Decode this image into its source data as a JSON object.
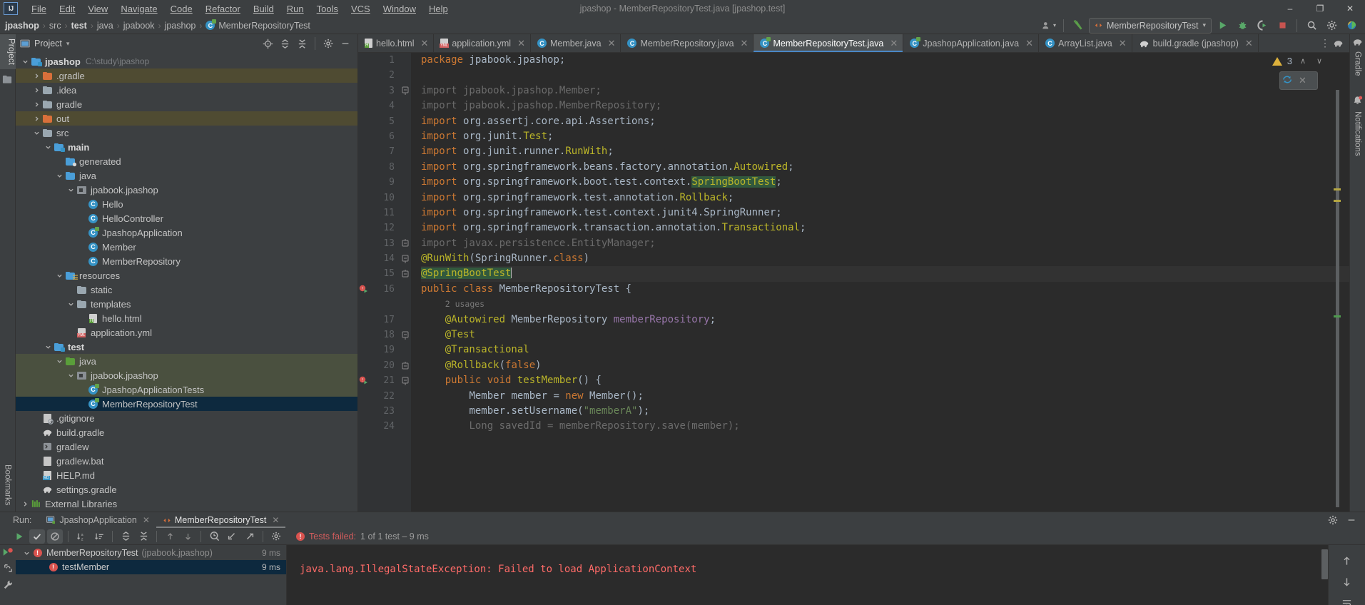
{
  "window": {
    "title": "jpashop - MemberRepositoryTest.java [jpashop.test]",
    "minimize": "–",
    "maximize": "❐",
    "close": "✕"
  },
  "menu": {
    "items": [
      "File",
      "Edit",
      "View",
      "Navigate",
      "Code",
      "Refactor",
      "Build",
      "Run",
      "Tools",
      "VCS",
      "Window",
      "Help"
    ]
  },
  "breadcrumb": {
    "items": [
      "jpashop",
      "src",
      "test",
      "java",
      "jpabook",
      "jpashop",
      "MemberRepositoryTest"
    ],
    "separator": "›"
  },
  "toolbar": {
    "run_config_label": "MemberRepositoryTest",
    "dropdown_caret": "▾",
    "run_title": "Run",
    "debug_title": "Debug",
    "coverage_title": "Run with Coverage",
    "stop_title": "Stop",
    "search_title": "Search Everywhere",
    "settings_title": "Settings",
    "updates_title": "Updates"
  },
  "project_panel": {
    "title": "Project",
    "caret": "▾",
    "actions": [
      "locate-icon",
      "expand-all-icon",
      "collapse-all-icon",
      "gear-icon",
      "hide-icon"
    ],
    "tree": [
      {
        "depth": 0,
        "arrow": "down",
        "icon": "module",
        "label": "jpashop",
        "bold": true,
        "path": "C:\\study\\jpashop",
        "state": ""
      },
      {
        "depth": 1,
        "arrow": "right",
        "icon": "folder-orange",
        "label": ".gradle",
        "state": "hl"
      },
      {
        "depth": 1,
        "arrow": "right",
        "icon": "folder",
        "label": ".idea",
        "state": ""
      },
      {
        "depth": 1,
        "arrow": "right",
        "icon": "folder",
        "label": "gradle",
        "state": ""
      },
      {
        "depth": 1,
        "arrow": "right",
        "icon": "folder-orange",
        "label": "out",
        "state": "hl"
      },
      {
        "depth": 1,
        "arrow": "down",
        "icon": "folder",
        "label": "src",
        "state": ""
      },
      {
        "depth": 2,
        "arrow": "down",
        "icon": "module",
        "label": "main",
        "bold": true,
        "state": ""
      },
      {
        "depth": 3,
        "arrow": "none",
        "icon": "folder-gen",
        "label": "generated",
        "state": ""
      },
      {
        "depth": 3,
        "arrow": "down",
        "icon": "folder-blue",
        "label": "java",
        "state": ""
      },
      {
        "depth": 4,
        "arrow": "down",
        "icon": "package",
        "label": "jpabook.jpashop",
        "state": ""
      },
      {
        "depth": 5,
        "arrow": "none",
        "icon": "class",
        "label": "Hello",
        "state": ""
      },
      {
        "depth": 5,
        "arrow": "none",
        "icon": "class",
        "label": "HelloController",
        "state": ""
      },
      {
        "depth": 5,
        "arrow": "none",
        "icon": "class-run",
        "label": "JpashopApplication",
        "state": ""
      },
      {
        "depth": 5,
        "arrow": "none",
        "icon": "class",
        "label": "Member",
        "state": ""
      },
      {
        "depth": 5,
        "arrow": "none",
        "icon": "class",
        "label": "MemberRepository",
        "state": ""
      },
      {
        "depth": 3,
        "arrow": "down",
        "icon": "folder-res",
        "label": "resources",
        "state": ""
      },
      {
        "depth": 4,
        "arrow": "none",
        "icon": "folder",
        "label": "static",
        "state": ""
      },
      {
        "depth": 4,
        "arrow": "down",
        "icon": "folder",
        "label": "templates",
        "state": ""
      },
      {
        "depth": 5,
        "arrow": "none",
        "icon": "file-html",
        "label": "hello.html",
        "state": ""
      },
      {
        "depth": 4,
        "arrow": "none",
        "icon": "file-yml",
        "label": "application.yml",
        "state": ""
      },
      {
        "depth": 2,
        "arrow": "down",
        "icon": "module",
        "label": "test",
        "bold": true,
        "state": ""
      },
      {
        "depth": 3,
        "arrow": "down",
        "icon": "folder-green",
        "label": "java",
        "state": "grp"
      },
      {
        "depth": 4,
        "arrow": "down",
        "icon": "package",
        "label": "jpabook.jpashop",
        "state": "grp"
      },
      {
        "depth": 5,
        "arrow": "none",
        "icon": "class-run",
        "label": "JpashopApplicationTests",
        "state": "grp"
      },
      {
        "depth": 5,
        "arrow": "none",
        "icon": "class-run",
        "label": "MemberRepositoryTest",
        "state": "sel"
      },
      {
        "depth": 1,
        "arrow": "none",
        "icon": "file-ignore",
        "label": ".gitignore",
        "state": ""
      },
      {
        "depth": 1,
        "arrow": "none",
        "icon": "gradle",
        "label": "build.gradle",
        "state": ""
      },
      {
        "depth": 1,
        "arrow": "none",
        "icon": "file-sh",
        "label": "gradlew",
        "state": ""
      },
      {
        "depth": 1,
        "arrow": "none",
        "icon": "file-bat",
        "label": "gradlew.bat",
        "state": ""
      },
      {
        "depth": 1,
        "arrow": "none",
        "icon": "file-md",
        "label": "HELP.md",
        "state": ""
      },
      {
        "depth": 1,
        "arrow": "none",
        "icon": "gradle",
        "label": "settings.gradle",
        "state": ""
      },
      {
        "depth": 0,
        "arrow": "right",
        "icon": "libs",
        "label": "External Libraries",
        "state": ""
      }
    ]
  },
  "left_rail": {
    "label": "Project"
  },
  "bottom_rail": {
    "label": "Bookmarks"
  },
  "right_rail": {
    "labels": [
      "Gradle",
      "Notifications"
    ]
  },
  "editor_tabs": {
    "tabs": [
      {
        "label": "hello.html",
        "icon": "file-html",
        "active": false
      },
      {
        "label": "application.yml",
        "icon": "file-yml",
        "active": false
      },
      {
        "label": "Member.java",
        "icon": "class",
        "active": false
      },
      {
        "label": "MemberRepository.java",
        "icon": "class",
        "active": false
      },
      {
        "label": "MemberRepositoryTest.java",
        "icon": "class-run",
        "active": true
      },
      {
        "label": "JpashopApplication.java",
        "icon": "class-run",
        "active": false
      },
      {
        "label": "ArrayList.java",
        "icon": "class",
        "active": false
      },
      {
        "label": "build.gradle (jpashop)",
        "icon": "gradle",
        "active": false
      }
    ],
    "close_glyph": "✕",
    "overflow_glyph": "⋮"
  },
  "editor": {
    "inspection_count": "3",
    "inspection_icon": "warning-triangle-icon",
    "prev_glyph": "∧",
    "next_glyph": "∨",
    "popup_close": "✕",
    "caret_line": 15,
    "lines": [
      {
        "n": 1,
        "fold": "",
        "gutter": "",
        "segments": [
          {
            "t": "package ",
            "c": "kw"
          },
          {
            "t": "jpabook.jpashop;",
            "c": ""
          }
        ]
      },
      {
        "n": 2,
        "fold": "",
        "gutter": "",
        "segments": []
      },
      {
        "n": 3,
        "fold": "start",
        "gutter": "",
        "segments": [
          {
            "t": "import jpabook.jpashop.Member;",
            "c": "dim"
          }
        ]
      },
      {
        "n": 4,
        "fold": "",
        "gutter": "",
        "segments": [
          {
            "t": "import jpabook.jpashop.MemberRepository;",
            "c": "dim"
          }
        ]
      },
      {
        "n": 5,
        "fold": "",
        "gutter": "",
        "segments": [
          {
            "t": "import ",
            "c": "kw"
          },
          {
            "t": "org.assertj.core.api.Assertions;",
            "c": ""
          }
        ]
      },
      {
        "n": 6,
        "fold": "",
        "gutter": "",
        "segments": [
          {
            "t": "import ",
            "c": "kw"
          },
          {
            "t": "org.junit.",
            "c": ""
          },
          {
            "t": "Test",
            "c": "ann"
          },
          {
            "t": ";",
            "c": ""
          }
        ]
      },
      {
        "n": 7,
        "fold": "",
        "gutter": "",
        "segments": [
          {
            "t": "import ",
            "c": "kw"
          },
          {
            "t": "org.junit.runner.",
            "c": ""
          },
          {
            "t": "RunWith",
            "c": "ann"
          },
          {
            "t": ";",
            "c": ""
          }
        ]
      },
      {
        "n": 8,
        "fold": "",
        "gutter": "",
        "segments": [
          {
            "t": "import ",
            "c": "kw"
          },
          {
            "t": "org.springframework.beans.factory.annotation.",
            "c": ""
          },
          {
            "t": "Autowired",
            "c": "ann"
          },
          {
            "t": ";",
            "c": ""
          }
        ]
      },
      {
        "n": 9,
        "fold": "",
        "gutter": "",
        "segments": [
          {
            "t": "import ",
            "c": "kw"
          },
          {
            "t": "org.springframework.boot.test.context.",
            "c": ""
          },
          {
            "t": "SpringBootTest",
            "c": "ann hlit"
          },
          {
            "t": ";",
            "c": ""
          }
        ]
      },
      {
        "n": 10,
        "fold": "",
        "gutter": "",
        "segments": [
          {
            "t": "import ",
            "c": "kw"
          },
          {
            "t": "org.springframework.test.annotation.",
            "c": ""
          },
          {
            "t": "Rollback",
            "c": "ann"
          },
          {
            "t": ";",
            "c": ""
          }
        ]
      },
      {
        "n": 11,
        "fold": "",
        "gutter": "",
        "segments": [
          {
            "t": "import ",
            "c": "kw"
          },
          {
            "t": "org.springframework.test.context.junit4.SpringRunner;",
            "c": ""
          }
        ]
      },
      {
        "n": 12,
        "fold": "",
        "gutter": "",
        "segments": [
          {
            "t": "import ",
            "c": "kw"
          },
          {
            "t": "org.springframework.transaction.annotation.",
            "c": ""
          },
          {
            "t": "Transactional",
            "c": "ann"
          },
          {
            "t": ";",
            "c": ""
          }
        ]
      },
      {
        "n": 13,
        "fold": "end",
        "gutter": "",
        "segments": [
          {
            "t": "import javax.persistence.EntityManager;",
            "c": "dim"
          }
        ]
      },
      {
        "n": 14,
        "fold": "start",
        "gutter": "",
        "segments": [
          {
            "t": "@RunWith",
            "c": "ann"
          },
          {
            "t": "(SpringRunner.",
            "c": ""
          },
          {
            "t": "class",
            "c": "kw"
          },
          {
            "t": ")",
            "c": ""
          }
        ]
      },
      {
        "n": 15,
        "fold": "end",
        "gutter": "",
        "segments": [
          {
            "t": "@SpringBootTest",
            "c": "ann hlit"
          }
        ]
      },
      {
        "n": 16,
        "fold": "",
        "gutter": "run",
        "segments": [
          {
            "t": "public class ",
            "c": "kw"
          },
          {
            "t": "MemberRepositoryTest",
            "c": ""
          },
          {
            "t": " {",
            "c": ""
          }
        ]
      },
      {
        "n": "",
        "fold": "",
        "gutter": "",
        "usage": "2 usages",
        "indent": 1,
        "segments": []
      },
      {
        "n": 17,
        "fold": "",
        "gutter": "",
        "indent": 1,
        "segments": [
          {
            "t": "@Autowired",
            "c": "ann"
          },
          {
            "t": " MemberRepository ",
            "c": ""
          },
          {
            "t": "memberRepository",
            "c": "fld"
          },
          {
            "t": ";",
            "c": ""
          }
        ]
      },
      {
        "n": 18,
        "fold": "start",
        "gutter": "",
        "indent": 1,
        "segments": [
          {
            "t": "@Test",
            "c": "ann"
          }
        ]
      },
      {
        "n": 19,
        "fold": "",
        "gutter": "",
        "indent": 1,
        "segments": [
          {
            "t": "@Transactional",
            "c": "ann"
          }
        ]
      },
      {
        "n": 20,
        "fold": "end",
        "gutter": "",
        "indent": 1,
        "segments": [
          {
            "t": "@Rollback",
            "c": "ann"
          },
          {
            "t": "(",
            "c": ""
          },
          {
            "t": "false",
            "c": "kw"
          },
          {
            "t": ")",
            "c": ""
          }
        ]
      },
      {
        "n": 21,
        "fold": "start",
        "gutter": "run",
        "indent": 1,
        "segments": [
          {
            "t": "public void ",
            "c": "kw"
          },
          {
            "t": "testMember",
            "c": "ann"
          },
          {
            "t": "() {",
            "c": ""
          }
        ]
      },
      {
        "n": 22,
        "fold": "",
        "gutter": "",
        "indent": 2,
        "segments": [
          {
            "t": "Member member = ",
            "c": ""
          },
          {
            "t": "new ",
            "c": "kw"
          },
          {
            "t": "Member();",
            "c": ""
          }
        ]
      },
      {
        "n": 23,
        "fold": "",
        "gutter": "",
        "indent": 2,
        "segments": [
          {
            "t": "member.setUsername(",
            "c": ""
          },
          {
            "t": "\"memberA\"",
            "c": "str"
          },
          {
            "t": ");",
            "c": ""
          }
        ]
      },
      {
        "n": 24,
        "fold": "",
        "gutter": "",
        "indent": 2,
        "segments": [
          {
            "t": "Long savedId = memberRepository.save(member);",
            "c": "dim"
          }
        ]
      }
    ]
  },
  "run_panel": {
    "run_label": "Run:",
    "tabs": [
      {
        "label": "JpashopApplication",
        "icon": "app-icon",
        "active": false
      },
      {
        "label": "MemberRepositoryTest",
        "icon": "test-icon",
        "active": true
      }
    ],
    "close_glyph": "✕",
    "toolbar_buttons": [
      "rerun-icon",
      "show-passed-icon",
      "show-ignored-icon",
      "sort-alpha-icon",
      "sort-duration-icon",
      "expand-all-icon",
      "collapse-all-icon",
      "prev-icon",
      "next-icon",
      "history-icon",
      "import-icon",
      "export-icon",
      "settings-icon"
    ],
    "status": {
      "prefix": "Tests failed:",
      "detail": "1 of 1 test – 9 ms"
    },
    "tests": [
      {
        "label": "MemberRepositoryTest",
        "suffix": "(jpabook.jpashop)",
        "time": "9 ms",
        "depth": 0,
        "arrow": "down",
        "selected": false
      },
      {
        "label": "testMember",
        "suffix": "",
        "time": "9 ms",
        "depth": 1,
        "arrow": "none",
        "selected": true
      }
    ],
    "console_error": "java.lang.IllegalStateException: Failed to load ApplicationContext",
    "panel_actions": [
      "gear-icon",
      "hide-icon"
    ],
    "console_actions": [
      "up-icon",
      "down-icon",
      "soft-wrap-icon"
    ]
  },
  "colors": {
    "accent_blue": "#3592c4",
    "selection": "#0d293e",
    "error_red": "#ff6b68",
    "annotation_yellow": "#bbb529",
    "keyword_orange": "#cc7832",
    "string_green": "#6a8759",
    "field_purple": "#9876aa"
  }
}
